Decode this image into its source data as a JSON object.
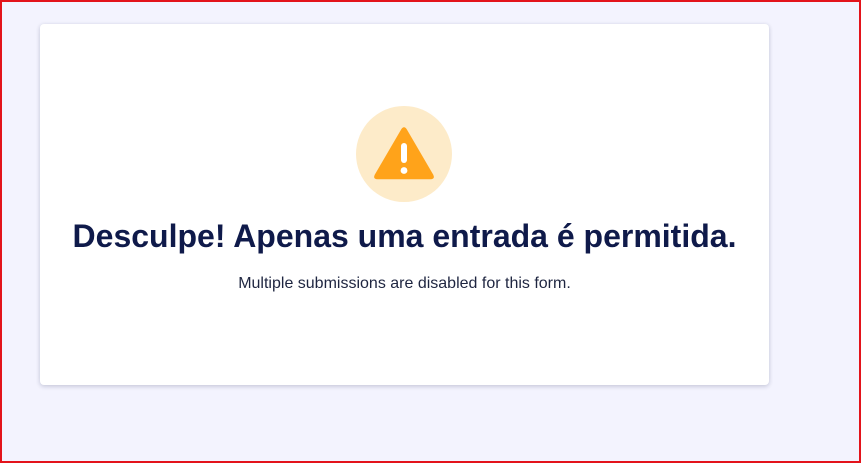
{
  "message": {
    "icon": "warning-triangle-icon",
    "title": "Desculpe! Apenas uma entrada é permitida.",
    "subtitle": "Multiple submissions are disabled for this form."
  },
  "colors": {
    "page_background": "#f3f3fe",
    "frame_border": "#e3131b",
    "card_background": "#ffffff",
    "icon_circle": "#fdebc9",
    "icon_triangle": "#ffa31a",
    "title_text": "#0f1a4a",
    "subtitle_text": "#1e2540"
  }
}
